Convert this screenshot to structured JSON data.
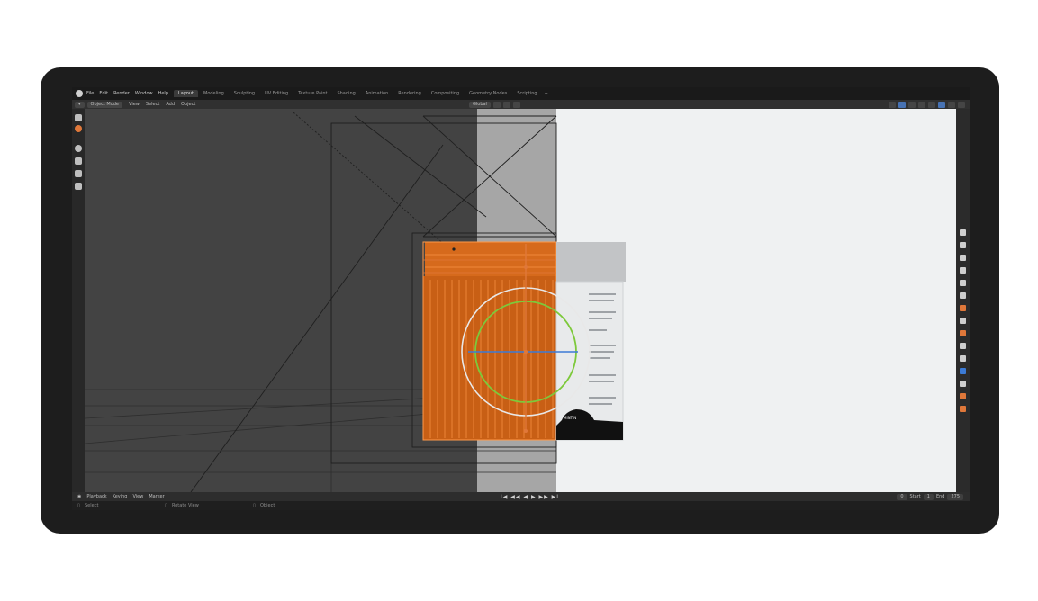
{
  "menubar": {
    "menus": [
      "File",
      "Edit",
      "Render",
      "Window",
      "Help"
    ],
    "workspaces": [
      "Layout",
      "Modeling",
      "Sculpting",
      "UV Editing",
      "Texture Paint",
      "Shading",
      "Animation",
      "Rendering",
      "Compositing",
      "Geometry Nodes",
      "Scripting"
    ],
    "active_workspace": "Layout",
    "add_tab": "+"
  },
  "header": {
    "mode": "Object Mode",
    "view": "View",
    "select": "Select",
    "add": "Add",
    "object": "Object",
    "orientation": "Global"
  },
  "timeline": {
    "playback": "Playback",
    "keying": "Keying",
    "view": "View",
    "marker": "Marker",
    "controls": "I◀ ◀◀ ◀ ▶ ▶▶ ▶I",
    "current_frame": "0",
    "start_label": "Start",
    "start_value": "1",
    "end_label": "End",
    "end_value": "275"
  },
  "statusbar": {
    "select": "Select",
    "rotate_view": "Rotate View",
    "object": "Object"
  },
  "jar_label": {
    "badge": "MINTIN"
  },
  "colors": {
    "accent": "#4772b3",
    "selection_orange": "#e0783a",
    "gizmo_green": "#7dc93b",
    "gizmo_blue": "#3c7bd6"
  }
}
